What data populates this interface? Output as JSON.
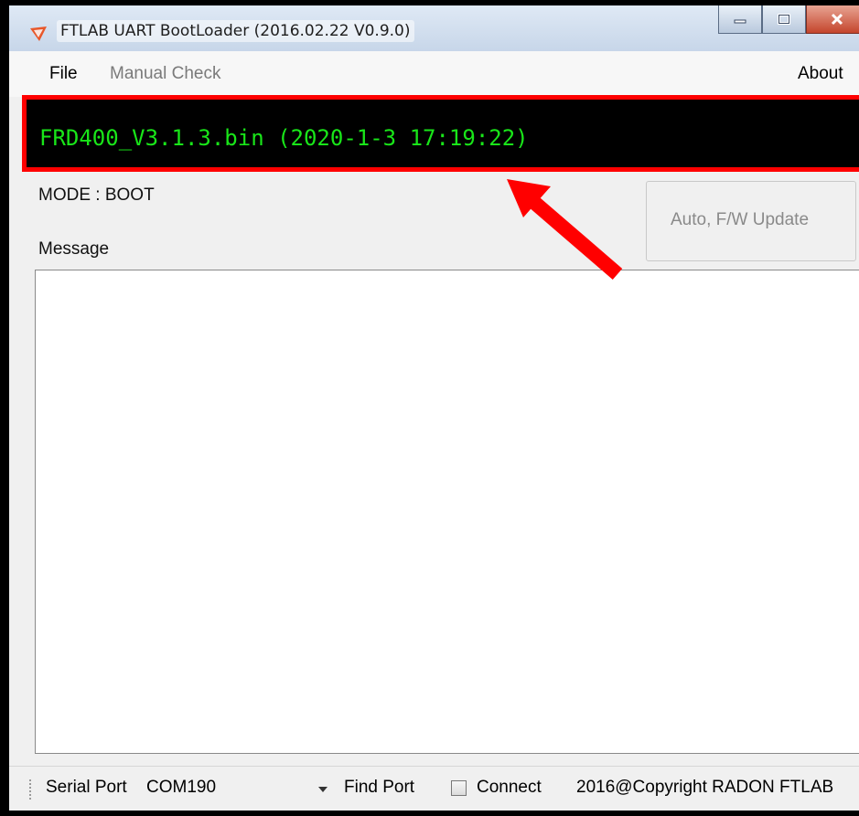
{
  "window": {
    "title": "FTLAB UART BootLoader (2016.02.22 V0.9.0)",
    "icon": "app-logo-icon",
    "controls": [
      "minimize-icon",
      "maximize-icon",
      "close-icon"
    ]
  },
  "menu": {
    "file": "File",
    "manual_check": "Manual Check",
    "about": "About"
  },
  "firmware": {
    "text": "FRD400_V3.1.3.bin (2020-1-3 17:19:22)",
    "text_color": "#19e619",
    "highlight_color": "#ff0000"
  },
  "mode": {
    "label": "MODE : BOOT"
  },
  "update_button": {
    "label": "Auto, F/W Update"
  },
  "message": {
    "label": "Message",
    "content": ""
  },
  "statusbar": {
    "serial_port_label": "Serial Port",
    "serial_port_value": "COM190",
    "find_port": "Find Port",
    "connect_label": "Connect",
    "connect_checked": false,
    "copyright": "2016@Copyright RADON FTLAB"
  },
  "annotation": {
    "arrow_color": "#ff0000",
    "icon": "red-arrow-icon"
  }
}
